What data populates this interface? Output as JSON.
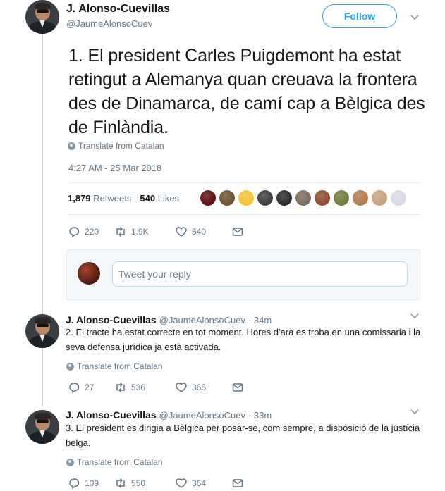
{
  "main_tweet": {
    "name": "J. Alonso-Cuevillas",
    "handle": "@JaumeAlonsoCuev",
    "follow_label": "Follow",
    "text": "1. El president Carles Puigdemont ha estat retingut a Alemanya quan creuava la frontera des de Dinamarca, de camí cap a Bèlgica des de Finlàndia.",
    "translate_label": "Translate from Catalan",
    "timestamp": "4:27 AM - 25 Mar 2018",
    "retweet_count": "1,879",
    "retweet_label": "Retweets",
    "like_count": "540",
    "like_label": "Likes",
    "actions": {
      "replies": "220",
      "retweets": "1.9K",
      "likes": "540"
    }
  },
  "likers_colors": [
    "#5a0d0d",
    "#6b4e2e",
    "#f2c230",
    "#3b3b3b",
    "#2a2a2a",
    "#7a6a5a",
    "#8d4a2f",
    "#6d7a3a",
    "#b07a4a",
    "#c7a07a",
    "#d8d8e8"
  ],
  "reply_box": {
    "placeholder": "Tweet your reply"
  },
  "replies": [
    {
      "name": "J. Alonso-Cuevillas",
      "handle": "@JaumeAlonsoCuev",
      "time": "· 34m",
      "text": "2. El tracte ha estat correcte en tot moment. Hores d'ara es troba en una comissaria i la seva defensa jurídica ja està activada.",
      "translate_label": "Translate from Catalan",
      "actions": {
        "replies": "27",
        "retweets": "536",
        "likes": "365"
      }
    },
    {
      "name": "J. Alonso-Cuevillas",
      "handle": "@JaumeAlonsoCuev",
      "time": "· 33m",
      "text": "3. El president es dirigia a Bèlgica per posar-se, com sempre, a disposició de la justícia belga.",
      "translate_label": "Translate from Catalan",
      "actions": {
        "replies": "109",
        "retweets": "550",
        "likes": "364"
      }
    }
  ],
  "colors": {
    "accent": "#1da1f2",
    "muted": "#657786",
    "text": "#14171a",
    "divider": "#e6ecf0"
  }
}
